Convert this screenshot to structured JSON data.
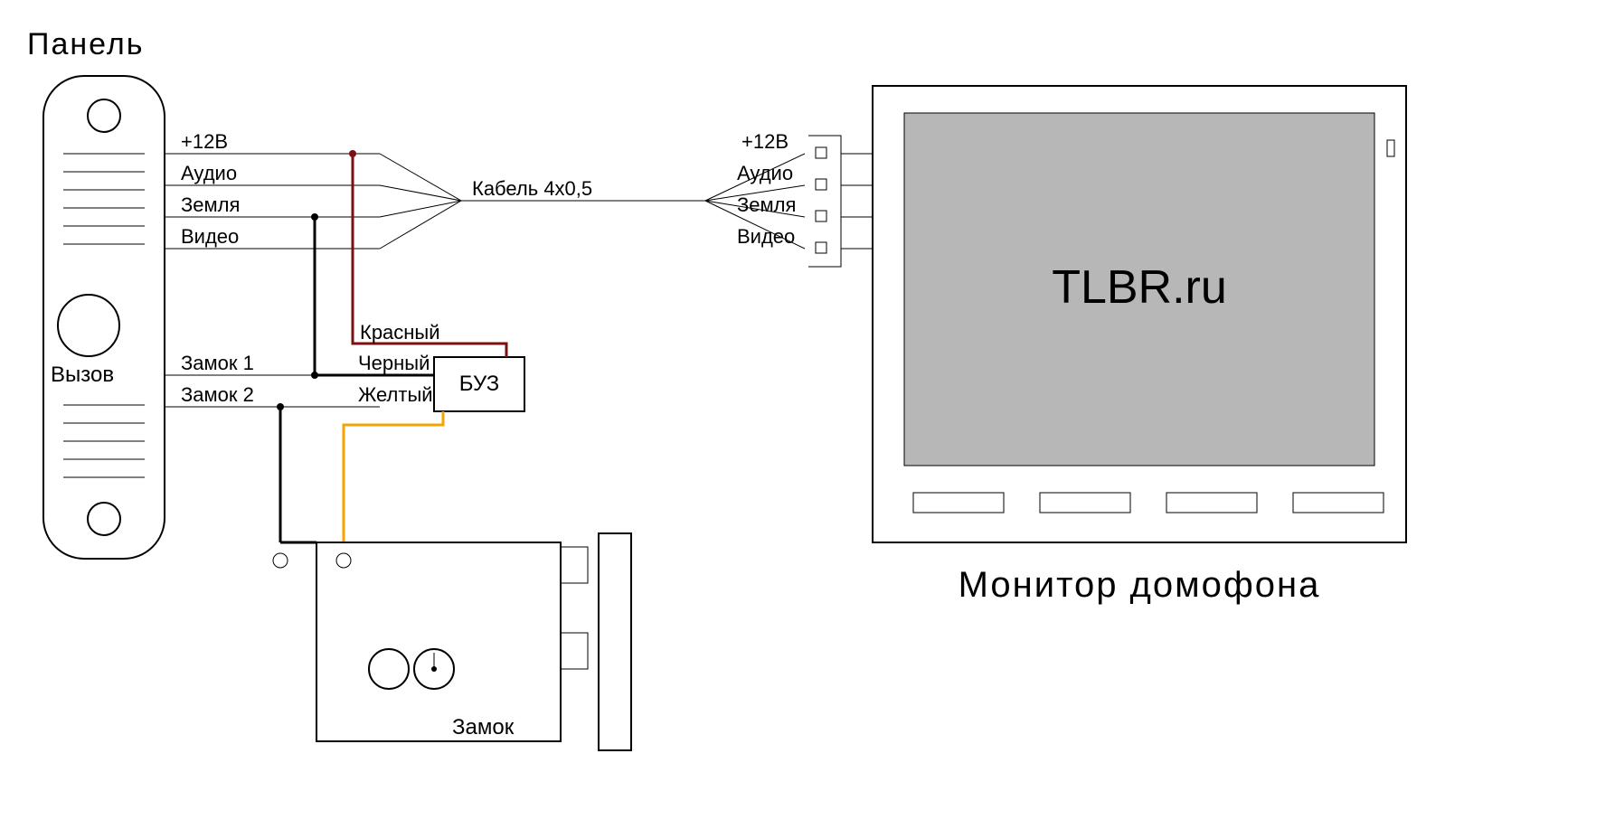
{
  "panel": {
    "title": "Панель",
    "call_label": "Вызов",
    "wires": {
      "v12": "+12В",
      "audio": "Аудио",
      "ground": "Земля",
      "video": "Видео",
      "lock1": "Замок 1",
      "lock2": "Замок 2"
    }
  },
  "cable": {
    "label": "Кабель 4х0,5"
  },
  "buz": {
    "label": "БУЗ",
    "wires": {
      "red": "Красный",
      "black": "Черный",
      "yellow": "Желтый"
    }
  },
  "lock": {
    "label": "Замок"
  },
  "monitor": {
    "title": "Монитор домофона",
    "screen_text": "TLBR.ru",
    "terminals": {
      "v12": "+12В",
      "audio": "Аудио",
      "ground": "Земля",
      "video": "Видео"
    }
  }
}
